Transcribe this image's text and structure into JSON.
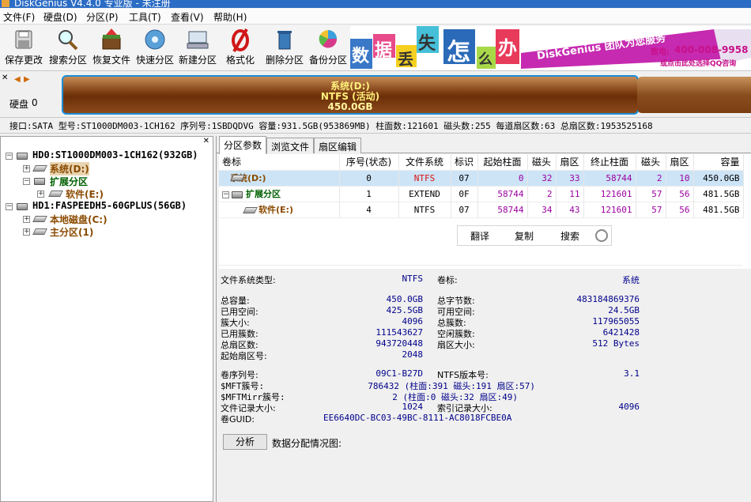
{
  "title": "DiskGenius V4.4.0 专业版 - 未注册",
  "menu": [
    "文件(F)",
    "硬盘(D)",
    "分区(P)",
    "工具(T)",
    "查看(V)",
    "帮助(H)"
  ],
  "toolbar": [
    {
      "label": "保存更改",
      "icon": "save-icon"
    },
    {
      "label": "搜索分区",
      "icon": "magnifier-icon"
    },
    {
      "label": "恢复文件",
      "icon": "recover-box-icon"
    },
    {
      "label": "快速分区",
      "icon": "disk-quick-icon"
    },
    {
      "label": "新建分区",
      "icon": "new-partition-icon"
    },
    {
      "label": "格式化",
      "icon": "format-icon"
    },
    {
      "label": "删除分区",
      "icon": "trash-icon"
    },
    {
      "label": "备份分区",
      "icon": "pie-backup-icon"
    }
  ],
  "banner": {
    "chars": [
      "数",
      "据",
      "丢",
      "失",
      "怎",
      "么",
      "办"
    ],
    "slogan": "DiskGenius 团队为您服务",
    "phone_label": "致电:",
    "phone": "400-008-9958",
    "qq": "或点击此处选择QQ咨询"
  },
  "disk": {
    "label": "硬盘",
    "index": "0",
    "partition_name": "系统(D:)",
    "partition_fs": "NTFS (活动)",
    "partition_size": "450.0GB"
  },
  "diskinfo": "接口:SATA  型号:ST1000DM003-1CH162  序列号:1SBDQDVG  容量:931.5GB(953869MB)  柱面数:121601  磁头数:255  每道扇区数:63  总扇区数:1953525168",
  "tree": [
    {
      "text": "HD0:ST1000DM003-1CH162(932GB)",
      "color": "#000000"
    },
    {
      "text": "系统(D:)",
      "color": "#8a4a00"
    },
    {
      "text": "扩展分区",
      "color": "#006000"
    },
    {
      "text": "软件(E:)",
      "color": "#8a4a00"
    },
    {
      "text": "HD1:FASPEEDH5-60GPLUS(56GB)",
      "color": "#000000"
    },
    {
      "text": "本地磁盘(C:)",
      "color": "#8a4a00"
    },
    {
      "text": "主分区(1)",
      "color": "#8a4a00"
    }
  ],
  "tabs": [
    "分区参数",
    "浏览文件",
    "扇区编辑"
  ],
  "table": {
    "headers": [
      "卷标",
      "序号(状态)",
      "文件系统",
      "标识",
      "起始柱面",
      "磁头",
      "扇区",
      "终止柱面",
      "磁头",
      "扇区",
      "容量"
    ],
    "rows": [
      [
        "系统(D:)",
        "0",
        "NTFS",
        "07",
        "0",
        "32",
        "33",
        "58744",
        "2",
        "10",
        "450.0GB"
      ],
      [
        "扩展分区",
        "1",
        "EXTEND",
        "0F",
        "58744",
        "2",
        "11",
        "121601",
        "57",
        "56",
        "481.5GB"
      ],
      [
        "软件(E:)",
        "4",
        "NTFS",
        "07",
        "58744",
        "34",
        "43",
        "121601",
        "57",
        "56",
        "481.5GB"
      ]
    ]
  },
  "actions": [
    "翻译",
    "复制",
    "搜索"
  ],
  "fs": {
    "fstype_label": "文件系统类型:",
    "fstype": "NTFS",
    "vol_label": "卷标:",
    "vol": "系统",
    "left": [
      {
        "k": "总容量:",
        "v": "450.0GB"
      },
      {
        "k": "已用空间:",
        "v": "425.5GB"
      },
      {
        "k": "簇大小:",
        "v": "4096"
      },
      {
        "k": "已用簇数:",
        "v": "111543627"
      },
      {
        "k": "总扇区数:",
        "v": "943720448"
      },
      {
        "k": "起始扇区号:",
        "v": "2048"
      }
    ],
    "right": [
      {
        "k": "总字节数:",
        "v": "483184869376"
      },
      {
        "k": "可用空间:",
        "v": "24.5GB"
      },
      {
        "k": "总簇数:",
        "v": "117965055"
      },
      {
        "k": "空闲簇数:",
        "v": "6421428"
      },
      {
        "k": "扇区大小:",
        "v": "512 Bytes"
      }
    ],
    "serial_label": "卷序列号:",
    "serial": "09C1-B27D",
    "ntfsver_label": "NTFS版本号:",
    "ntfsver": "3.1",
    "mft_label": "$MFT簇号:",
    "mft": "786432 (柱面:391 磁头:191 扇区:57)",
    "mftmirr_label": "$MFTMirr簇号:",
    "mftmirr": "2 (柱面:0 磁头:32 扇区:49)",
    "recsize_label": "文件记录大小:",
    "recsize": "1024",
    "idxsize_label": "索引记录大小:",
    "idxsize": "4096",
    "guid_label": "卷GUID:",
    "guid": "EE6640DC-BC03-49BC-8111-AC8018FCBE0A"
  },
  "analyze_label": "分析",
  "dist_label": "数据分配情况图:"
}
